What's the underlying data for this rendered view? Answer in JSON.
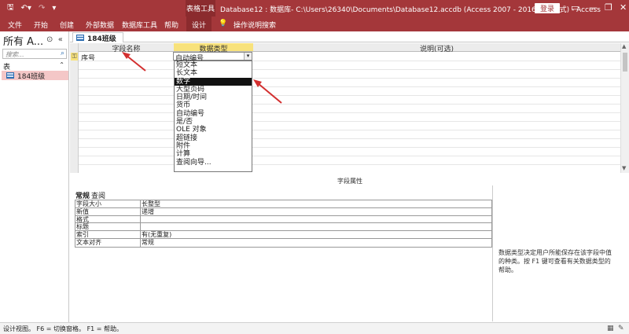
{
  "titlebar": {
    "qat_icons": [
      "save-icon",
      "undo-icon",
      "redo-icon",
      "customize-icon"
    ],
    "context_tab_header": "表格工具",
    "title": "Database12 : 数据库- C:\\Users\\26340\\Documents\\Database12.accdb (Access 2007 - 2016 文件格式)  -  Access",
    "login_label": "登录",
    "window_controls": [
      "restore-ribbon-icon",
      "minimize-icon",
      "maximize-icon",
      "close-icon"
    ]
  },
  "ribbon": {
    "tabs": [
      "文件",
      "开始",
      "创建",
      "外部数据",
      "数据库工具",
      "帮助",
      "设计"
    ],
    "active_tab": "设计",
    "tell_me": "操作说明搜索"
  },
  "nav": {
    "header": "所有 A...",
    "search_placeholder": "搜索...",
    "group": "表",
    "items": [
      {
        "label": "184班级",
        "icon": "table-icon"
      }
    ]
  },
  "document": {
    "tab_label": "184班级",
    "columns": [
      "字段名称",
      "数据类型",
      "说明(可选)"
    ],
    "rows": [
      {
        "field": "序号",
        "type": "自动编号"
      }
    ],
    "dropdown_options": [
      "短文本",
      "长文本",
      "数字",
      "大型页码",
      "日期/时间",
      "货币",
      "自动编号",
      "是/否",
      "OLE 对象",
      "超链接",
      "附件",
      "计算",
      "查阅向导..."
    ],
    "dropdown_highlighted": "数字"
  },
  "properties": {
    "title": "字段属性",
    "tabs": [
      "常规",
      "查阅"
    ],
    "rows": [
      {
        "key": "字段大小",
        "value": "长整型"
      },
      {
        "key": "新值",
        "value": "递增"
      },
      {
        "key": "格式",
        "value": ""
      },
      {
        "key": "标题",
        "value": ""
      },
      {
        "key": "索引",
        "value": "有(无重复)"
      },
      {
        "key": "文本对齐",
        "value": "常规"
      }
    ],
    "help_text": "数据类型决定用户所能保存在该字段中值的种类。按 F1 键可查看有关数据类型的帮助。"
  },
  "statusbar": {
    "text": "设计视图。  F6 = 切换窗格。  F1 = 帮助。"
  },
  "colors": {
    "ribbon": "#a4373a",
    "highlight_row": "#111111",
    "arrow": "#d32f2f",
    "header_selected": "#f8e27c"
  }
}
